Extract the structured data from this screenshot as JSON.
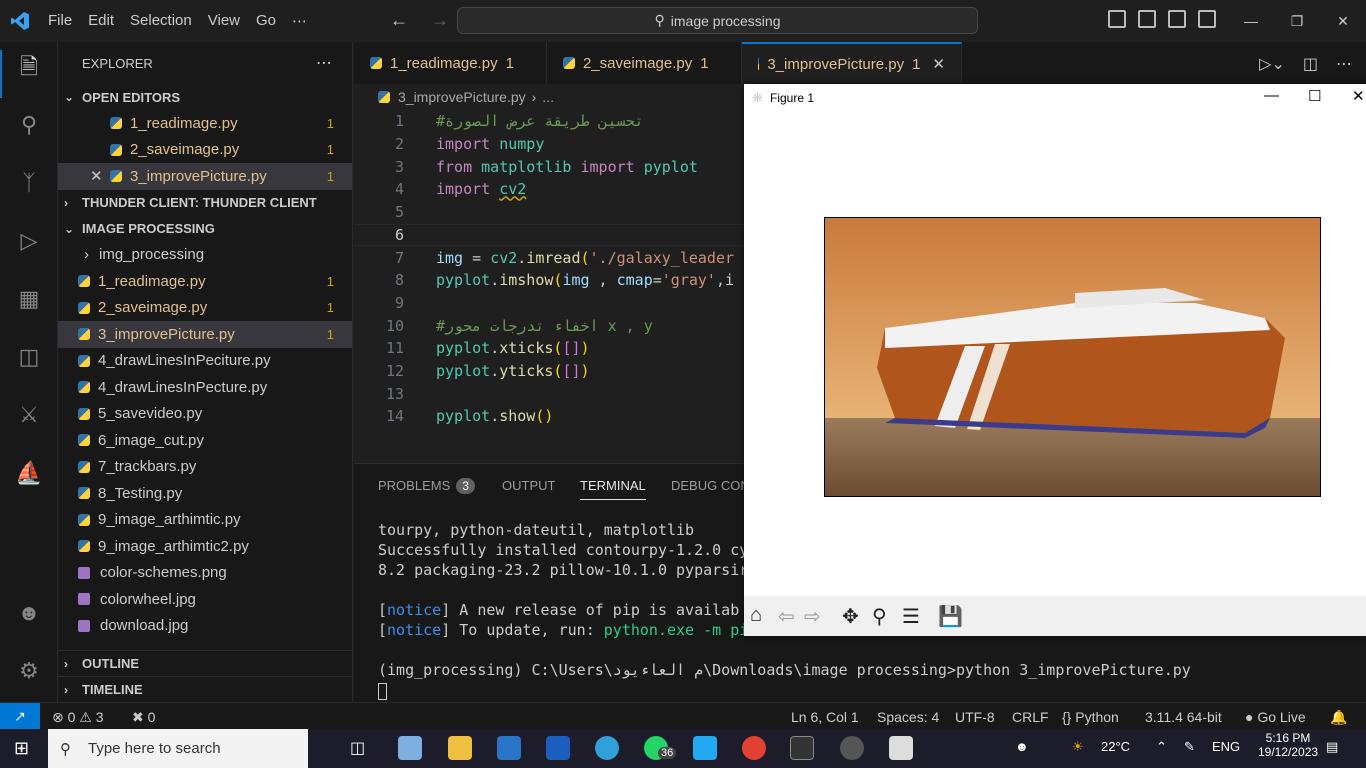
{
  "window": {
    "menu": [
      "File",
      "Edit",
      "Selection",
      "View",
      "Go",
      "⋯"
    ],
    "search_text": "image processing"
  },
  "sidebar": {
    "header": "EXPLORER",
    "open_editors_label": "OPEN EDITORS",
    "open_editors": [
      {
        "name": "1_readimage.py",
        "badge": "1"
      },
      {
        "name": "2_saveimage.py",
        "badge": "1"
      },
      {
        "name": "3_improvePicture.py",
        "badge": "1"
      }
    ],
    "thunder_label": "THUNDER CLIENT: THUNDER CLIENT",
    "project_label": "IMAGE PROCESSING",
    "folder": "img_processing",
    "files": [
      {
        "name": "1_readimage.py",
        "badge": "1"
      },
      {
        "name": "2_saveimage.py",
        "badge": "1"
      },
      {
        "name": "3_improvePicture.py",
        "badge": "1"
      },
      {
        "name": "4_drawLinesInPeciture.py",
        "badge": ""
      },
      {
        "name": "4_drawLinesInPecture.py",
        "badge": ""
      },
      {
        "name": "5_savevideo.py",
        "badge": ""
      },
      {
        "name": "6_image_cut.py",
        "badge": ""
      },
      {
        "name": "7_trackbars.py",
        "badge": ""
      },
      {
        "name": "8_Testing.py",
        "badge": ""
      },
      {
        "name": "9_image_arthimtic.py",
        "badge": ""
      },
      {
        "name": "9_image_arthimtic2.py",
        "badge": ""
      },
      {
        "name": "color-schemes.png",
        "badge": ""
      },
      {
        "name": "colorwheel.jpg",
        "badge": ""
      },
      {
        "name": "download.jpg",
        "badge": ""
      }
    ],
    "outline_label": "OUTLINE",
    "timeline_label": "TIMELINE"
  },
  "tabs": [
    {
      "name": "1_readimage.py",
      "count": "1"
    },
    {
      "name": "2_saveimage.py",
      "count": "1"
    },
    {
      "name": "3_improvePicture.py",
      "count": "1"
    }
  ],
  "breadcrumb": {
    "file": "3_improvePicture.py",
    "rest": "..."
  },
  "editor": {
    "line_numbers": [
      "1",
      "2",
      "3",
      "4",
      "5",
      "6",
      "7",
      "8",
      "9",
      "10",
      "11",
      "12",
      "13",
      "14"
    ],
    "l1": "#تحسين طريقة عرض الصورة",
    "l10": "#اخفاء تدرجات محور x , y",
    "import": "import",
    "from": "from",
    "numpy": "numpy",
    "matplotlib": "matplotlib",
    "pyplot": "pyplot",
    "cv2": "cv2",
    "img": "img",
    "imread": "imread",
    "imread_arg": "'./galaxy_leader",
    "imshow": "imshow",
    "cmap": "cmap",
    "gray": "'gray'",
    "xticks": "xticks",
    "yticks": "yticks",
    "show": "show"
  },
  "panel": {
    "tabs": [
      "PROBLEMS",
      "OUTPUT",
      "TERMINAL",
      "DEBUG CON"
    ],
    "problems_count": "3",
    "terminal": {
      "line1": "tourpy, python-dateutil, matplotlib",
      "line2": "Successfully installed contourpy-1.2.0 cy",
      "line3": "8.2 packaging-23.2 pillow-10.1.0 pyparsir",
      "notice": "notice",
      "notice1_rest": " A new release of pip is availab",
      "notice2_rest": " To update, run: ",
      "notice2_cmd": "python.exe -m pi",
      "prompt": "(img_processing) C:\\Users\\م العاءيود\\Downloads\\image processing>python 3_improvePicture.py"
    }
  },
  "figure": {
    "title": "Figure 1"
  },
  "statusbar": {
    "errors": "0",
    "warnings": "3",
    "ports": "0",
    "position": "Ln 6, Col 1",
    "spaces": "Spaces: 4",
    "encoding": "UTF-8",
    "eol": "CRLF",
    "language": "Python",
    "interpreter": "3.11.4 64-bit",
    "golive": "Go Live"
  },
  "taskbar": {
    "search_placeholder": "Type here to search",
    "whatsapp_badge": "36",
    "temperature": "22°C",
    "lang": "ENG",
    "time": "5:16 PM",
    "date": "19/12/2023"
  },
  "colors": {
    "accent": "#0078d4",
    "modified": "#e2c08d"
  }
}
